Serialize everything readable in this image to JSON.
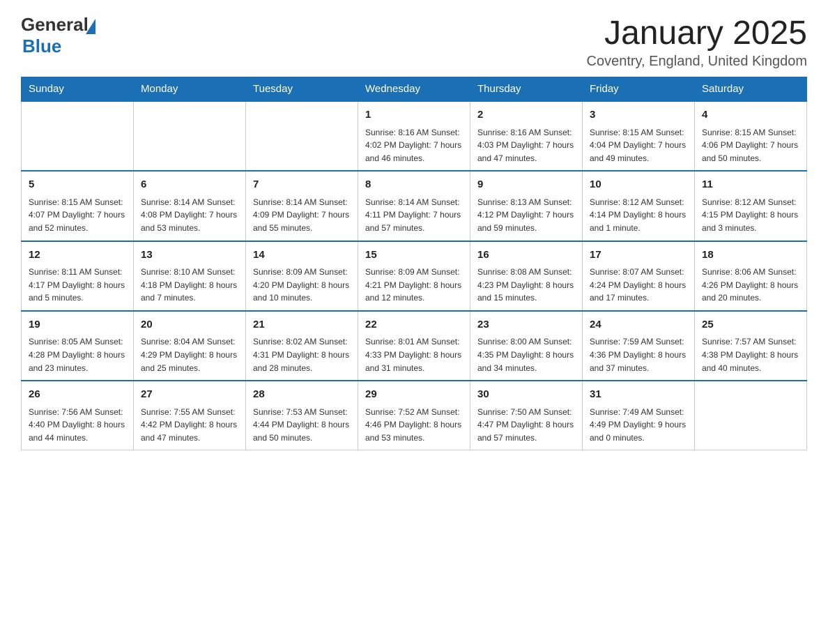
{
  "header": {
    "logo_general": "General",
    "logo_blue": "Blue",
    "month_title": "January 2025",
    "location": "Coventry, England, United Kingdom"
  },
  "days_of_week": [
    "Sunday",
    "Monday",
    "Tuesday",
    "Wednesday",
    "Thursday",
    "Friday",
    "Saturday"
  ],
  "weeks": [
    [
      {
        "day": "",
        "info": ""
      },
      {
        "day": "",
        "info": ""
      },
      {
        "day": "",
        "info": ""
      },
      {
        "day": "1",
        "info": "Sunrise: 8:16 AM\nSunset: 4:02 PM\nDaylight: 7 hours\nand 46 minutes."
      },
      {
        "day": "2",
        "info": "Sunrise: 8:16 AM\nSunset: 4:03 PM\nDaylight: 7 hours\nand 47 minutes."
      },
      {
        "day": "3",
        "info": "Sunrise: 8:15 AM\nSunset: 4:04 PM\nDaylight: 7 hours\nand 49 minutes."
      },
      {
        "day": "4",
        "info": "Sunrise: 8:15 AM\nSunset: 4:06 PM\nDaylight: 7 hours\nand 50 minutes."
      }
    ],
    [
      {
        "day": "5",
        "info": "Sunrise: 8:15 AM\nSunset: 4:07 PM\nDaylight: 7 hours\nand 52 minutes."
      },
      {
        "day": "6",
        "info": "Sunrise: 8:14 AM\nSunset: 4:08 PM\nDaylight: 7 hours\nand 53 minutes."
      },
      {
        "day": "7",
        "info": "Sunrise: 8:14 AM\nSunset: 4:09 PM\nDaylight: 7 hours\nand 55 minutes."
      },
      {
        "day": "8",
        "info": "Sunrise: 8:14 AM\nSunset: 4:11 PM\nDaylight: 7 hours\nand 57 minutes."
      },
      {
        "day": "9",
        "info": "Sunrise: 8:13 AM\nSunset: 4:12 PM\nDaylight: 7 hours\nand 59 minutes."
      },
      {
        "day": "10",
        "info": "Sunrise: 8:12 AM\nSunset: 4:14 PM\nDaylight: 8 hours\nand 1 minute."
      },
      {
        "day": "11",
        "info": "Sunrise: 8:12 AM\nSunset: 4:15 PM\nDaylight: 8 hours\nand 3 minutes."
      }
    ],
    [
      {
        "day": "12",
        "info": "Sunrise: 8:11 AM\nSunset: 4:17 PM\nDaylight: 8 hours\nand 5 minutes."
      },
      {
        "day": "13",
        "info": "Sunrise: 8:10 AM\nSunset: 4:18 PM\nDaylight: 8 hours\nand 7 minutes."
      },
      {
        "day": "14",
        "info": "Sunrise: 8:09 AM\nSunset: 4:20 PM\nDaylight: 8 hours\nand 10 minutes."
      },
      {
        "day": "15",
        "info": "Sunrise: 8:09 AM\nSunset: 4:21 PM\nDaylight: 8 hours\nand 12 minutes."
      },
      {
        "day": "16",
        "info": "Sunrise: 8:08 AM\nSunset: 4:23 PM\nDaylight: 8 hours\nand 15 minutes."
      },
      {
        "day": "17",
        "info": "Sunrise: 8:07 AM\nSunset: 4:24 PM\nDaylight: 8 hours\nand 17 minutes."
      },
      {
        "day": "18",
        "info": "Sunrise: 8:06 AM\nSunset: 4:26 PM\nDaylight: 8 hours\nand 20 minutes."
      }
    ],
    [
      {
        "day": "19",
        "info": "Sunrise: 8:05 AM\nSunset: 4:28 PM\nDaylight: 8 hours\nand 23 minutes."
      },
      {
        "day": "20",
        "info": "Sunrise: 8:04 AM\nSunset: 4:29 PM\nDaylight: 8 hours\nand 25 minutes."
      },
      {
        "day": "21",
        "info": "Sunrise: 8:02 AM\nSunset: 4:31 PM\nDaylight: 8 hours\nand 28 minutes."
      },
      {
        "day": "22",
        "info": "Sunrise: 8:01 AM\nSunset: 4:33 PM\nDaylight: 8 hours\nand 31 minutes."
      },
      {
        "day": "23",
        "info": "Sunrise: 8:00 AM\nSunset: 4:35 PM\nDaylight: 8 hours\nand 34 minutes."
      },
      {
        "day": "24",
        "info": "Sunrise: 7:59 AM\nSunset: 4:36 PM\nDaylight: 8 hours\nand 37 minutes."
      },
      {
        "day": "25",
        "info": "Sunrise: 7:57 AM\nSunset: 4:38 PM\nDaylight: 8 hours\nand 40 minutes."
      }
    ],
    [
      {
        "day": "26",
        "info": "Sunrise: 7:56 AM\nSunset: 4:40 PM\nDaylight: 8 hours\nand 44 minutes."
      },
      {
        "day": "27",
        "info": "Sunrise: 7:55 AM\nSunset: 4:42 PM\nDaylight: 8 hours\nand 47 minutes."
      },
      {
        "day": "28",
        "info": "Sunrise: 7:53 AM\nSunset: 4:44 PM\nDaylight: 8 hours\nand 50 minutes."
      },
      {
        "day": "29",
        "info": "Sunrise: 7:52 AM\nSunset: 4:46 PM\nDaylight: 8 hours\nand 53 minutes."
      },
      {
        "day": "30",
        "info": "Sunrise: 7:50 AM\nSunset: 4:47 PM\nDaylight: 8 hours\nand 57 minutes."
      },
      {
        "day": "31",
        "info": "Sunrise: 7:49 AM\nSunset: 4:49 PM\nDaylight: 9 hours\nand 0 minutes."
      },
      {
        "day": "",
        "info": ""
      }
    ]
  ]
}
